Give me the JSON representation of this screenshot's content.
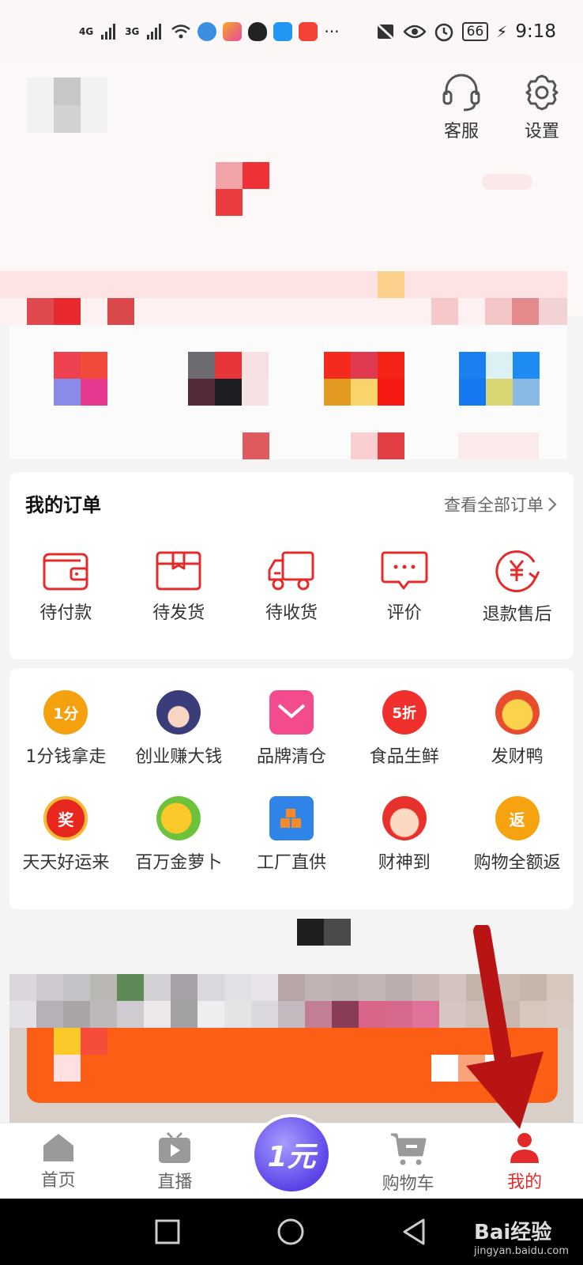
{
  "status_bar": {
    "signal_1": "4G",
    "signal_2": "3G",
    "more": "···",
    "battery": "66",
    "time": "9:18"
  },
  "header": {
    "service_label": "客服",
    "settings_label": "设置"
  },
  "orders": {
    "title": "我的订单",
    "view_all": "查看全部订单",
    "items": [
      {
        "label": "待付款",
        "icon": "wallet-icon"
      },
      {
        "label": "待发货",
        "icon": "package-icon"
      },
      {
        "label": "待收货",
        "icon": "truck-icon"
      },
      {
        "label": "评价",
        "icon": "comment-icon"
      },
      {
        "label": "退款售后",
        "icon": "refund-icon"
      }
    ]
  },
  "services": {
    "row1": [
      {
        "label": "1分钱拿走",
        "icon_text": "1分"
      },
      {
        "label": "创业赚大钱",
        "icon_text": ""
      },
      {
        "label": "品牌清仓",
        "icon_text": ""
      },
      {
        "label": "食品生鲜",
        "icon_text": "5折"
      },
      {
        "label": "发财鸭",
        "icon_text": ""
      }
    ],
    "row2": [
      {
        "label": "天天好运来",
        "icon_text": "奖"
      },
      {
        "label": "百万金萝卜",
        "icon_text": ""
      },
      {
        "label": "工厂直供",
        "icon_text": ""
      },
      {
        "label": "财神到",
        "icon_text": ""
      },
      {
        "label": "购物全额返",
        "icon_text": "返"
      }
    ]
  },
  "tabbar": {
    "home": "首页",
    "live": "直播",
    "one_yuan": "1元",
    "cart": "购物车",
    "mine": "我的"
  },
  "watermark": {
    "brand": "Bai经验",
    "url": "jingyan.baidu.com"
  },
  "colors": {
    "accent_red": "#e42b2b",
    "orange": "#fb5e14",
    "purple": "#5b45e8"
  }
}
